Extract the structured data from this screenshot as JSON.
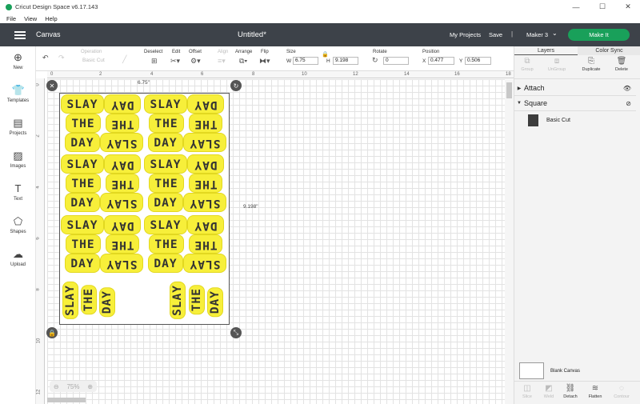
{
  "window": {
    "title": "Cricut Design Space  v6.17.143",
    "minimize": "—",
    "maximize": "☐",
    "close": "✕"
  },
  "menu": [
    "File",
    "View",
    "Help"
  ],
  "header": {
    "section": "Canvas",
    "document": "Untitled*",
    "my_projects": "My Projects",
    "save": "Save",
    "separator": "|",
    "machine": "Maker 3",
    "make_it": "Make It"
  },
  "sidebar": [
    {
      "label": "New",
      "icon": "plus-circle-icon"
    },
    {
      "label": "Templates",
      "icon": "shirt-icon"
    },
    {
      "label": "Projects",
      "icon": "projects-icon"
    },
    {
      "label": "Images",
      "icon": "image-icon"
    },
    {
      "label": "Text",
      "icon": "text-icon"
    },
    {
      "label": "Shapes",
      "icon": "shapes-icon"
    },
    {
      "label": "Upload",
      "icon": "cloud-upload-icon"
    }
  ],
  "toolbar": {
    "operation_label": "Operation",
    "operation_value": "Basic Cut",
    "deselect": "Deselect",
    "edit": "Edit",
    "offset": "Offset",
    "align": "Align",
    "arrange": "Arrange",
    "flip": "Flip",
    "size": "Size",
    "w_label": "W",
    "w_value": "6.75",
    "h_label": "H",
    "h_value": "9.198",
    "rotate": "Rotate",
    "rotate_value": "0",
    "position": "Position",
    "x_label": "X",
    "x_value": "0.477",
    "y_label": "Y",
    "y_value": "0.506"
  },
  "ruler": {
    "h": [
      "0",
      "2",
      "4",
      "6",
      "8",
      "10",
      "12",
      "14",
      "16",
      "18"
    ],
    "v": [
      "0",
      "2",
      "4",
      "6",
      "8",
      "10",
      "12"
    ]
  },
  "canvas": {
    "width_label": "6.75\"",
    "height_label": "9.198\"",
    "zoom": "75%",
    "words": {
      "w1": "SLAY",
      "w2": "THE",
      "w3": "DAY"
    }
  },
  "panel": {
    "tabs": [
      "Layers",
      "Color Sync"
    ],
    "actions": [
      "Group",
      "UnGroup",
      "Duplicate",
      "Delete"
    ],
    "layers": [
      {
        "name": "Attach"
      },
      {
        "name": "Square",
        "child": "Basic Cut"
      }
    ],
    "blank_canvas": "Blank Canvas",
    "bottom_actions": [
      "Slice",
      "Weld",
      "Detach",
      "Flatten",
      "Contour"
    ]
  }
}
